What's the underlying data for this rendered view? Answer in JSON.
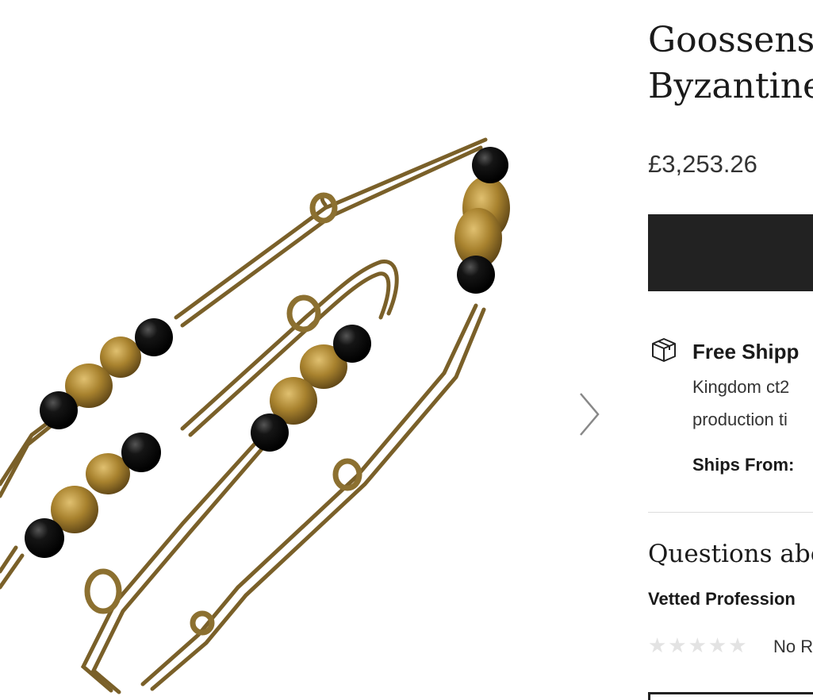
{
  "product": {
    "title_line1": "Goossens",
    "title_line2": "Byzantine",
    "price": "£3,253.26"
  },
  "gallery": {
    "image_subject": "necklace-image",
    "next_icon": "chevron-right-icon"
  },
  "shipping": {
    "icon": "package-icon",
    "title": "Free Shipp",
    "line1": "Kingdom ct2",
    "line2": "production ti",
    "ships_from_label": "Ships From:"
  },
  "questions": {
    "heading": "Questions abo",
    "vetted_label": "Vetted Profession",
    "stars_text": "★★★★★",
    "no_reviews_text": "No R"
  },
  "colors": {
    "cta_background": "#222222",
    "gold": "#8a6a2e",
    "onyx": "#0d0d0d"
  }
}
